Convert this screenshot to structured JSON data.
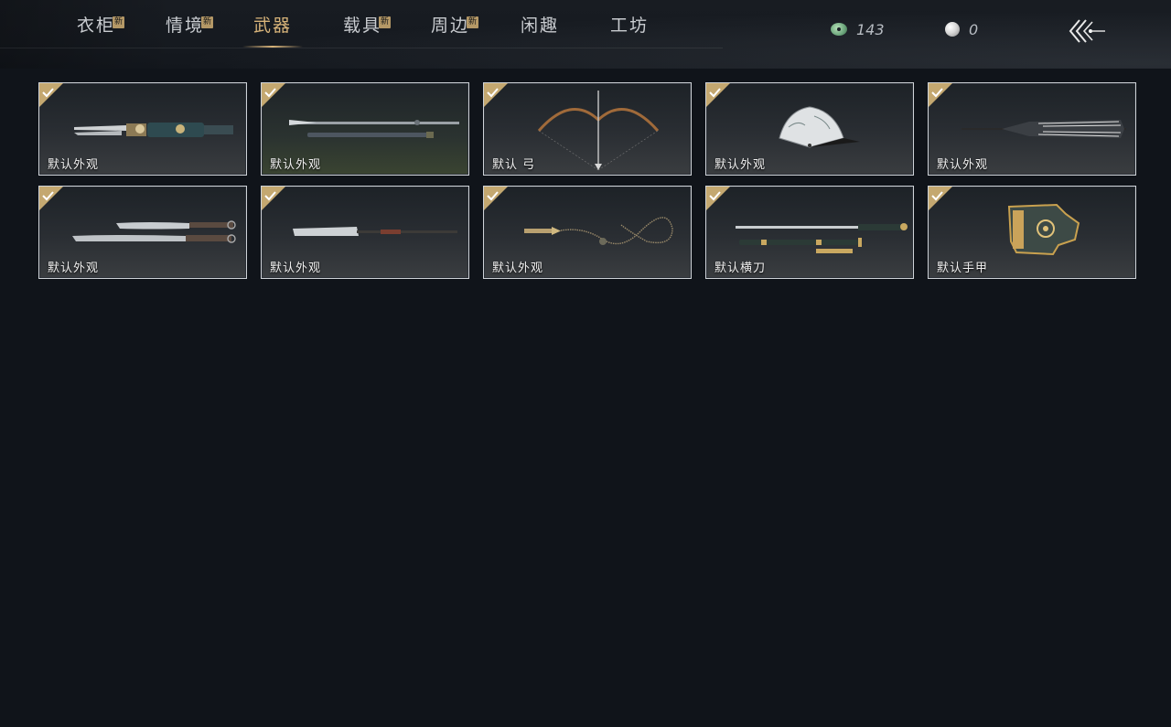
{
  "tabs": [
    {
      "label": "衣柜",
      "new": true,
      "active": false,
      "badge": "新"
    },
    {
      "label": "情境",
      "new": true,
      "active": false,
      "badge": "新"
    },
    {
      "label": "武器",
      "new": false,
      "active": true
    },
    {
      "label": "载具",
      "new": true,
      "active": false,
      "badge": "新"
    },
    {
      "label": "周边",
      "new": true,
      "active": false,
      "badge": "新"
    },
    {
      "label": "闲趣",
      "new": false,
      "active": false
    },
    {
      "label": "工坊",
      "new": false,
      "active": false
    }
  ],
  "currency": {
    "jade": {
      "icon": "jade-coin-icon",
      "amount": "143"
    },
    "pearl": {
      "icon": "pearl-icon",
      "amount": "0"
    }
  },
  "back": {
    "icon": "back-arrow-icon"
  },
  "items": [
    {
      "label": "默认外观",
      "icon": "dual-blades-icon",
      "equipped": true
    },
    {
      "label": "默认外观",
      "icon": "spear-icon",
      "equipped": true
    },
    {
      "label": "默认 弓",
      "icon": "bow-icon",
      "equipped": true
    },
    {
      "label": "默认外观",
      "icon": "fan-icon",
      "equipped": true
    },
    {
      "label": "默认外观",
      "icon": "umbrella-icon",
      "equipped": true
    },
    {
      "label": "默认外观",
      "icon": "twin-sabres-icon",
      "equipped": true
    },
    {
      "label": "默认外观",
      "icon": "glaive-icon",
      "equipped": true
    },
    {
      "label": "默认外观",
      "icon": "rope-dart-icon",
      "equipped": true
    },
    {
      "label": "默认横刀",
      "icon": "hengdao-icon",
      "equipped": true
    },
    {
      "label": "默认手甲",
      "icon": "gauntlet-icon",
      "equipped": true
    }
  ],
  "colors": {
    "accent": "#d8b47a",
    "badge": "#b49866",
    "background": "#10141a"
  }
}
